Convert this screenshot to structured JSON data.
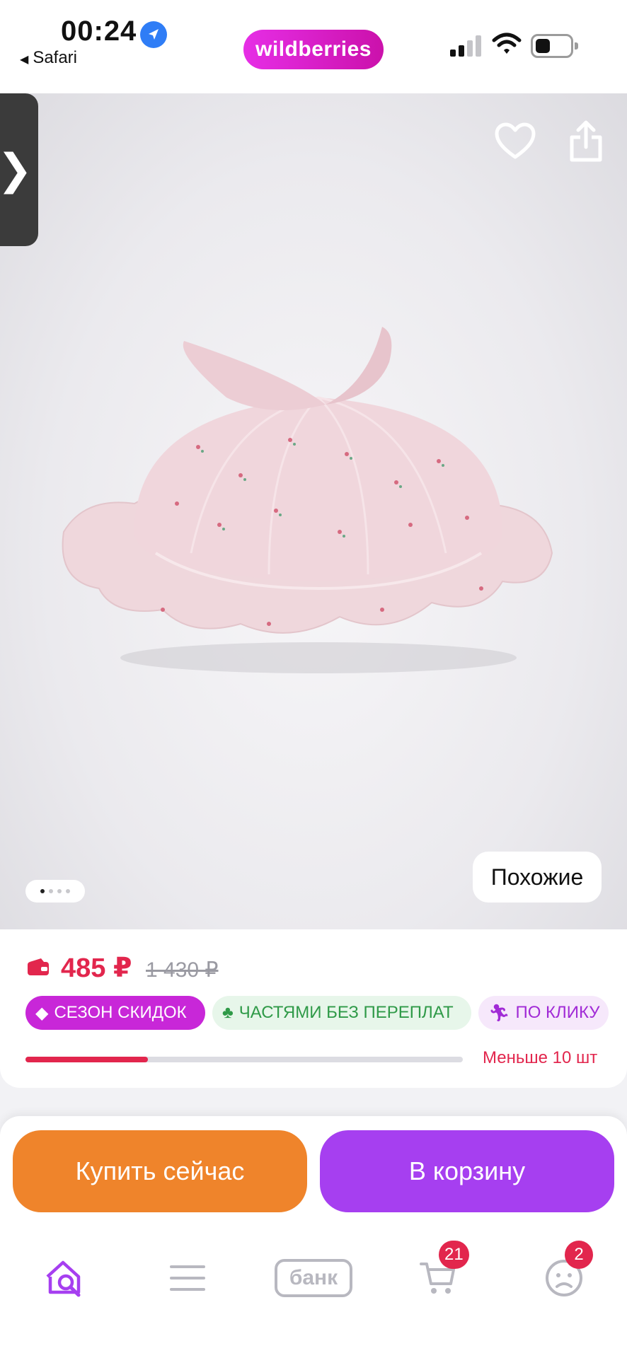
{
  "status_bar": {
    "time": "00:24",
    "back_app": "Safari",
    "brand": "wildberries",
    "icons": [
      "location-arrow-icon",
      "signal-icon",
      "wifi-icon",
      "battery-icon"
    ]
  },
  "gallery": {
    "similar_label": "Похожие",
    "image_count": 4,
    "active_image": 1,
    "icons": [
      "chevron-right-icon",
      "heart-icon",
      "share-icon"
    ]
  },
  "price": {
    "current": "485 ₽",
    "old": "1 430 ₽",
    "badges": [
      {
        "label": "СЕЗОН СКИДОК",
        "icon": "tag-icon"
      },
      {
        "label": "ЧАСТЯМИ БЕЗ ПЕРЕПЛАТ",
        "icon": "clover-icon"
      },
      {
        "label": "ПО КЛИКУ",
        "icon": "running-icon"
      }
    ],
    "stock_label": "Меньше 10 шт",
    "stock_fraction": 0.28
  },
  "actions": {
    "buy_now": "Купить сейчас",
    "to_cart": "В корзину"
  },
  "tabbar": {
    "bank_label": "банк",
    "cart_count": "21",
    "profile_count": "2"
  },
  "colors": {
    "brand": "#cb11ab",
    "price": "#e2264d",
    "buy_now": "#ef842b",
    "to_cart": "#a63ff0",
    "home_active": "#a63ff0"
  }
}
